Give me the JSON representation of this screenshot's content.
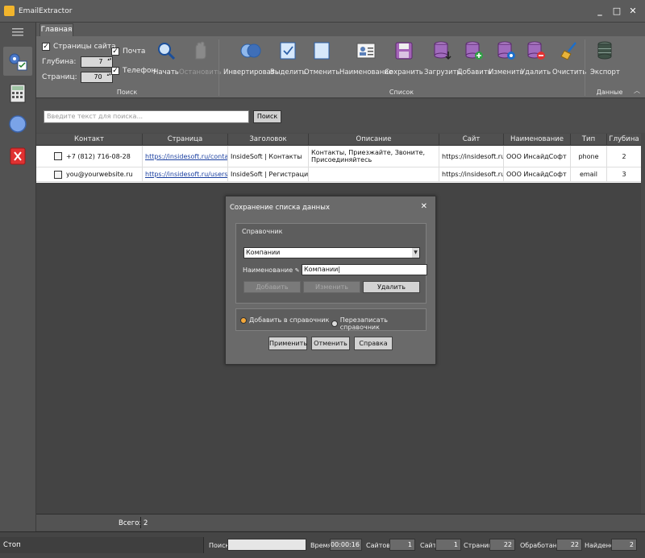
{
  "window": {
    "title": "EmailExtractor",
    "minimize_label": "_",
    "maximize_label": "□",
    "close_label": "✕"
  },
  "ribbon": {
    "tab_main": "Главная",
    "search_group": {
      "label": "Поиск",
      "pages_site": "Страницы сайта",
      "mail": "Почта",
      "phone": "Телефон",
      "depth_label": "Глубина:",
      "depth_value": "7",
      "pages_label": "Страниц:",
      "pages_value": "70",
      "start": "Начать",
      "stop": "Остановить"
    },
    "list_group": {
      "label": "Список",
      "invert": "Инвертировать",
      "select": "Выделить",
      "cancel": "Отменить",
      "name": "Наименование",
      "save": "Сохранить",
      "load": "Загрузить",
      "add": "Добавить",
      "edit": "Изменить",
      "delete": "Удалить",
      "clear": "Очистить"
    },
    "data_group": {
      "label": "Данные",
      "export": "Экспорт"
    }
  },
  "search": {
    "placeholder": "Введите текст для поиска...",
    "button": "Поиск"
  },
  "grid": {
    "headers": [
      "Контакт",
      "Страница",
      "Заголовок",
      "Описание",
      "Сайт",
      "Наименование",
      "Тип",
      "Глубина"
    ],
    "rows": [
      {
        "contact": "+7 (812) 716-08-28",
        "page": "https://insidesoft.ru/contacts/",
        "title": "InsideSoft | Контакты",
        "description": "Контакты, Приезжайте, Звоните, Присоединяйтесь",
        "site": "https://insidesoft.ru/",
        "name": "ООО ИнсайдСофт",
        "type": "phone",
        "depth": "2"
      },
      {
        "contact": "you@yourwebsite.ru",
        "page": "https://insidesoft.ru/users/reg...",
        "title": "InsideSoft | Регистрация",
        "description": "",
        "site": "https://insidesoft.ru/",
        "name": "ООО ИнсайдСофт",
        "type": "email",
        "depth": "3"
      }
    ],
    "total_label": "Всего: 2"
  },
  "dialog": {
    "title": "Сохранение списка данных",
    "close": "✕",
    "group_title": "Справочник",
    "combo_value": "Компании",
    "name_label": "Наименование",
    "name_value": "Компании",
    "add": "Добавить",
    "edit": "Изменить",
    "delete": "Удалить",
    "radio_add": "Добавить в справочник",
    "radio_overwrite": "Перезаписать справочник",
    "apply": "Применить",
    "cancel": "Отменить",
    "help": "Справка"
  },
  "status": {
    "stop": "Стоп",
    "search_label": "Поиск",
    "time_label": "Время",
    "time_value": "00:00:16",
    "sites_label": "Сайтов",
    "sites_value": "1",
    "site_label": "Сайт",
    "site_value": "1",
    "pages_label": "Страниц",
    "pages_value": "22",
    "processed_label": "Обработано",
    "processed_value": "22",
    "found_label": "Найдено",
    "found_value": "2"
  },
  "colors": {
    "accent_orange": "#f4a83a",
    "link_blue": "#1a3fa0",
    "delete_red": "#e03131"
  }
}
